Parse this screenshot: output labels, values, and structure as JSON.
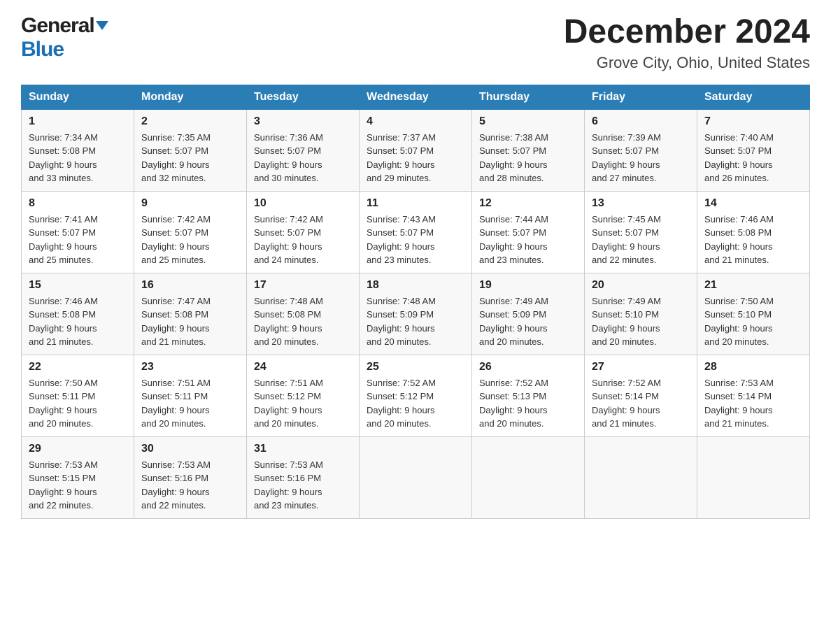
{
  "logo": {
    "general": "General",
    "blue": "Blue"
  },
  "header": {
    "title": "December 2024",
    "subtitle": "Grove City, Ohio, United States"
  },
  "days": [
    "Sunday",
    "Monday",
    "Tuesday",
    "Wednesday",
    "Thursday",
    "Friday",
    "Saturday"
  ],
  "weeks": [
    [
      {
        "date": "1",
        "sunrise": "7:34 AM",
        "sunset": "5:08 PM",
        "daylight": "9 hours and 33 minutes."
      },
      {
        "date": "2",
        "sunrise": "7:35 AM",
        "sunset": "5:07 PM",
        "daylight": "9 hours and 32 minutes."
      },
      {
        "date": "3",
        "sunrise": "7:36 AM",
        "sunset": "5:07 PM",
        "daylight": "9 hours and 30 minutes."
      },
      {
        "date": "4",
        "sunrise": "7:37 AM",
        "sunset": "5:07 PM",
        "daylight": "9 hours and 29 minutes."
      },
      {
        "date": "5",
        "sunrise": "7:38 AM",
        "sunset": "5:07 PM",
        "daylight": "9 hours and 28 minutes."
      },
      {
        "date": "6",
        "sunrise": "7:39 AM",
        "sunset": "5:07 PM",
        "daylight": "9 hours and 27 minutes."
      },
      {
        "date": "7",
        "sunrise": "7:40 AM",
        "sunset": "5:07 PM",
        "daylight": "9 hours and 26 minutes."
      }
    ],
    [
      {
        "date": "8",
        "sunrise": "7:41 AM",
        "sunset": "5:07 PM",
        "daylight": "9 hours and 25 minutes."
      },
      {
        "date": "9",
        "sunrise": "7:42 AM",
        "sunset": "5:07 PM",
        "daylight": "9 hours and 25 minutes."
      },
      {
        "date": "10",
        "sunrise": "7:42 AM",
        "sunset": "5:07 PM",
        "daylight": "9 hours and 24 minutes."
      },
      {
        "date": "11",
        "sunrise": "7:43 AM",
        "sunset": "5:07 PM",
        "daylight": "9 hours and 23 minutes."
      },
      {
        "date": "12",
        "sunrise": "7:44 AM",
        "sunset": "5:07 PM",
        "daylight": "9 hours and 23 minutes."
      },
      {
        "date": "13",
        "sunrise": "7:45 AM",
        "sunset": "5:07 PM",
        "daylight": "9 hours and 22 minutes."
      },
      {
        "date": "14",
        "sunrise": "7:46 AM",
        "sunset": "5:08 PM",
        "daylight": "9 hours and 21 minutes."
      }
    ],
    [
      {
        "date": "15",
        "sunrise": "7:46 AM",
        "sunset": "5:08 PM",
        "daylight": "9 hours and 21 minutes."
      },
      {
        "date": "16",
        "sunrise": "7:47 AM",
        "sunset": "5:08 PM",
        "daylight": "9 hours and 21 minutes."
      },
      {
        "date": "17",
        "sunrise": "7:48 AM",
        "sunset": "5:08 PM",
        "daylight": "9 hours and 20 minutes."
      },
      {
        "date": "18",
        "sunrise": "7:48 AM",
        "sunset": "5:09 PM",
        "daylight": "9 hours and 20 minutes."
      },
      {
        "date": "19",
        "sunrise": "7:49 AM",
        "sunset": "5:09 PM",
        "daylight": "9 hours and 20 minutes."
      },
      {
        "date": "20",
        "sunrise": "7:49 AM",
        "sunset": "5:10 PM",
        "daylight": "9 hours and 20 minutes."
      },
      {
        "date": "21",
        "sunrise": "7:50 AM",
        "sunset": "5:10 PM",
        "daylight": "9 hours and 20 minutes."
      }
    ],
    [
      {
        "date": "22",
        "sunrise": "7:50 AM",
        "sunset": "5:11 PM",
        "daylight": "9 hours and 20 minutes."
      },
      {
        "date": "23",
        "sunrise": "7:51 AM",
        "sunset": "5:11 PM",
        "daylight": "9 hours and 20 minutes."
      },
      {
        "date": "24",
        "sunrise": "7:51 AM",
        "sunset": "5:12 PM",
        "daylight": "9 hours and 20 minutes."
      },
      {
        "date": "25",
        "sunrise": "7:52 AM",
        "sunset": "5:12 PM",
        "daylight": "9 hours and 20 minutes."
      },
      {
        "date": "26",
        "sunrise": "7:52 AM",
        "sunset": "5:13 PM",
        "daylight": "9 hours and 20 minutes."
      },
      {
        "date": "27",
        "sunrise": "7:52 AM",
        "sunset": "5:14 PM",
        "daylight": "9 hours and 21 minutes."
      },
      {
        "date": "28",
        "sunrise": "7:53 AM",
        "sunset": "5:14 PM",
        "daylight": "9 hours and 21 minutes."
      }
    ],
    [
      {
        "date": "29",
        "sunrise": "7:53 AM",
        "sunset": "5:15 PM",
        "daylight": "9 hours and 22 minutes."
      },
      {
        "date": "30",
        "sunrise": "7:53 AM",
        "sunset": "5:16 PM",
        "daylight": "9 hours and 22 minutes."
      },
      {
        "date": "31",
        "sunrise": "7:53 AM",
        "sunset": "5:16 PM",
        "daylight": "9 hours and 23 minutes."
      },
      null,
      null,
      null,
      null
    ]
  ],
  "labels": {
    "sunrise": "Sunrise:",
    "sunset": "Sunset:",
    "daylight": "Daylight:"
  }
}
